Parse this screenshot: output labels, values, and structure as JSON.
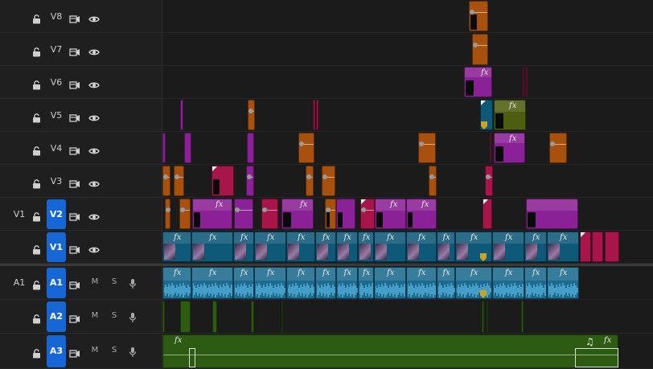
{
  "video_tracks": [
    {
      "name": "V8",
      "source": "",
      "boxed": false
    },
    {
      "name": "V7",
      "source": "",
      "boxed": false
    },
    {
      "name": "V6",
      "source": "",
      "boxed": false
    },
    {
      "name": "V5",
      "source": "",
      "boxed": false
    },
    {
      "name": "V4",
      "source": "",
      "boxed": false
    },
    {
      "name": "V3",
      "source": "",
      "boxed": false
    },
    {
      "name": "V2",
      "source": "V1",
      "boxed": true
    },
    {
      "name": "V1",
      "source": "",
      "boxed": true
    }
  ],
  "audio_tracks": [
    {
      "name": "A1",
      "source": "A1",
      "mute": "M",
      "solo": "S"
    },
    {
      "name": "A2",
      "source": "",
      "mute": "M",
      "solo": "S"
    },
    {
      "name": "A3",
      "source": "",
      "mute": "M",
      "solo": "S"
    }
  ],
  "clip_fx_label": "fx",
  "music_note": "♫",
  "icons": [
    "lock-icon",
    "sync-lock-icon",
    "eye-icon",
    "microphone-icon",
    "music-note-icon"
  ],
  "colors": {
    "track_button": "#1766d6",
    "clip_orange": "#a8500e",
    "clip_purple": "#8a2196",
    "clip_magenta": "#a8154a",
    "clip_olive": "#4e5e10",
    "clip_teal": "#0e5878",
    "audio_blue": "#1c6a8e",
    "audio_green": "#2d5b12"
  }
}
